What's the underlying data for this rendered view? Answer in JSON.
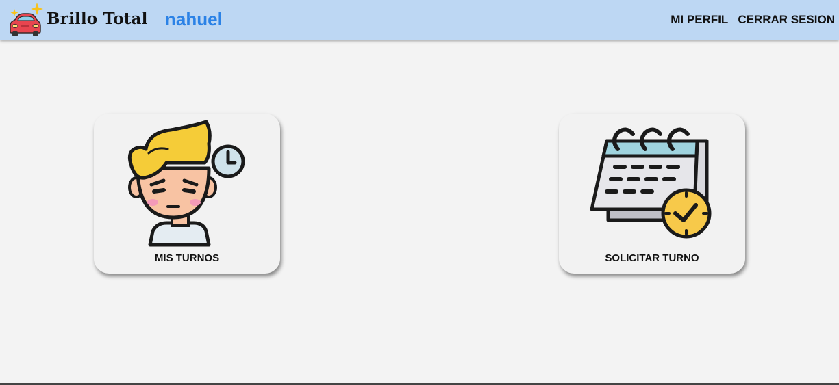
{
  "header": {
    "brand": "Brillo Total",
    "username": "nahuel",
    "nav": {
      "profile_label": "MI PERFIL",
      "logout_label": "CERRAR SESION"
    },
    "logo_icon": "car-sparkle-icon",
    "background": "#bdd7f3",
    "username_color": "#2b82e6"
  },
  "main": {
    "cards": [
      {
        "label": "MIS TURNOS",
        "icon": "person-clock-icon"
      },
      {
        "label": "SOLICITAR TURNO",
        "icon": "calendar-clock-icon"
      }
    ]
  }
}
